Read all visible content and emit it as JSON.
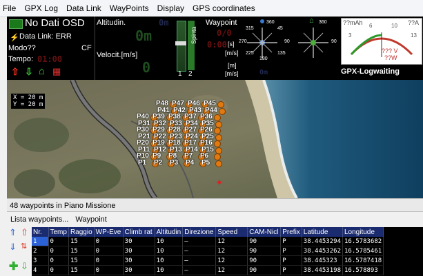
{
  "menubar": {
    "items": [
      "File",
      "GPX Log",
      "Data Link",
      "WayPoints",
      "Display",
      "GPS coordinates"
    ]
  },
  "osd": {
    "status": "No Dati OSD",
    "data_link": "Data Link: ERR",
    "modo": "Modo??",
    "cf": "CF",
    "tempo_label": "Tempo:",
    "tempo_value": "01:00",
    "altitude_label": "Altitudin.",
    "altitude_value": "0m",
    "altitude_display": "0m",
    "velocity_label": "Velocit.[m/s]",
    "velocity_value": "0",
    "spinta_label": "Spinta",
    "slider_labels": [
      "1",
      "2"
    ],
    "waypoint_label": "Waypoint",
    "waypoint_value": "0/0",
    "wp_time": "0:00",
    "unit_s": "[s]",
    "unit_ms": "[m/s]",
    "unit_m": "[m]",
    "unit_ms2": "[m/s]",
    "wp_dist": "0m",
    "compass1_top": "360",
    "compass2_top": "360",
    "compass_marks": [
      "315",
      "45",
      "270",
      "90",
      "225",
      "135",
      "180"
    ],
    "battery": {
      "mah": "??mAh",
      "amp": "??A",
      "ticks": [
        "6",
        "10",
        "3",
        "13"
      ],
      "volt": "??? V",
      "watt": "??W"
    },
    "gpx_status": "GPX-Logwaiting"
  },
  "map": {
    "scale_x": "X = 20 m",
    "scale_y": "Y = 20 m",
    "wp_labels": [
      "P48",
      "P47",
      "P46",
      "P45",
      "P41",
      "P42",
      "P43",
      "P44",
      "P40",
      "P39",
      "P38",
      "P37",
      "P36",
      "P31",
      "P32",
      "P33",
      "P34",
      "P35",
      "P30",
      "P29",
      "P28",
      "P27",
      "P26",
      "P21",
      "P22",
      "P23",
      "P24",
      "P25",
      "P20",
      "P19",
      "P18",
      "P17",
      "P16",
      "P11",
      "P12",
      "P13",
      "P14",
      "P15",
      "P10",
      "P9",
      "P8",
      "P7",
      "P6",
      "P1",
      "P2",
      "P3",
      "P4",
      "P5"
    ]
  },
  "status": {
    "text": "48 waypoints in Piano Missione"
  },
  "panel_menu": {
    "items": [
      "Lista waypoints...",
      "Waypoint"
    ]
  },
  "table": {
    "columns": [
      "Nr.",
      "Temp",
      "Raggio",
      "WP-Eve",
      "Climb rat",
      "Altitudin",
      "Direzione",
      "Speed",
      "CAM-Nicl",
      "Prefix",
      "Latitude",
      "Longitude"
    ],
    "rows": [
      [
        "1",
        "0",
        "15",
        "0",
        "30",
        "10",
        "—",
        "12",
        "90",
        "P",
        "38.4453294",
        "16.5783682"
      ],
      [
        "2",
        "0",
        "15",
        "0",
        "30",
        "10",
        "—",
        "12",
        "90",
        "P",
        "38.4453262",
        "16.5785461"
      ],
      [
        "3",
        "0",
        "15",
        "0",
        "30",
        "10",
        "—",
        "12",
        "90",
        "P",
        "38.445323",
        "16.5787418"
      ],
      [
        "4",
        "0",
        "15",
        "0",
        "30",
        "10",
        "—",
        "12",
        "90",
        "P",
        "38.4453198",
        "16.578893"
      ]
    ]
  },
  "colors": {
    "osd_bg": "#000000",
    "table_header": "#1b2b70",
    "selection": "#2b62d6",
    "waypoint": "#e07a10"
  }
}
